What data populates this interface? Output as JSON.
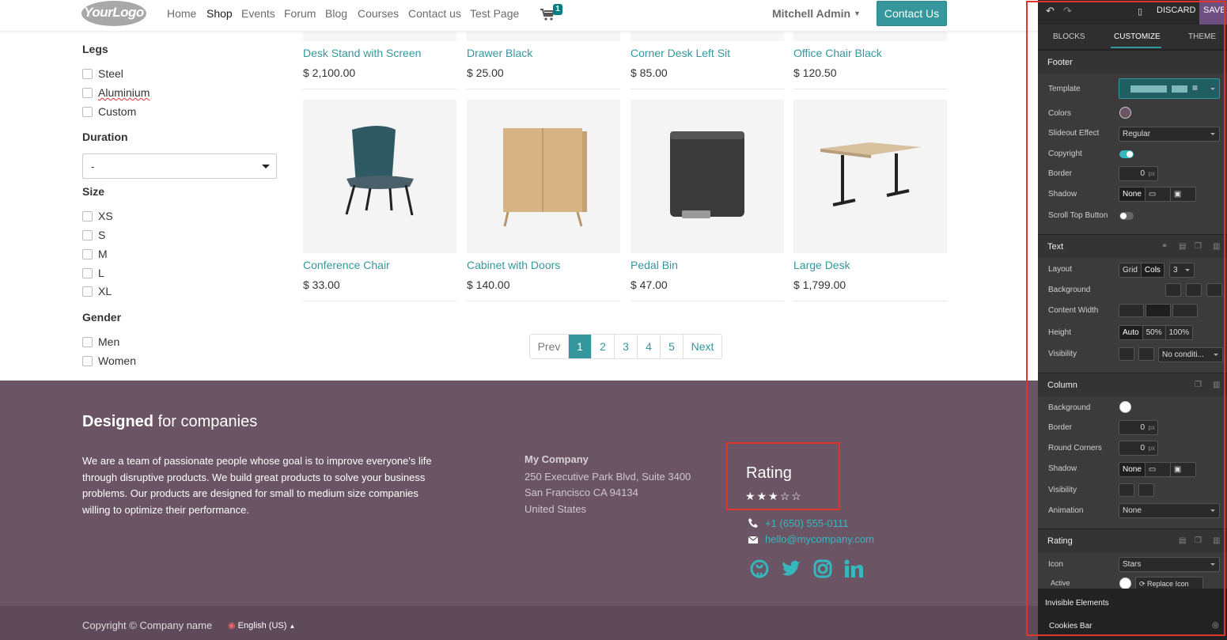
{
  "nav": {
    "logo": "YourLogo",
    "menu": [
      "Home",
      "Shop",
      "Events",
      "Forum",
      "Blog",
      "Courses",
      "Contact us",
      "Test Page"
    ],
    "active_menu": "Shop",
    "cart_count": "1",
    "user": "Mitchell Admin",
    "contact_button": "Contact Us"
  },
  "filters": {
    "legs": {
      "title": "Legs",
      "options": [
        "Steel",
        "Aluminium",
        "Custom"
      ]
    },
    "duration": {
      "title": "Duration",
      "value": "-"
    },
    "size": {
      "title": "Size",
      "options": [
        "XS",
        "S",
        "M",
        "L",
        "XL"
      ]
    },
    "gender": {
      "title": "Gender",
      "options": [
        "Men",
        "Women"
      ]
    }
  },
  "products_top": [
    {
      "name": "Desk Stand with Screen",
      "price": "$ 2,100.00"
    },
    {
      "name": "Drawer Black",
      "price": "$ 25.00"
    },
    {
      "name": "Corner Desk Left Sit",
      "price": "$ 85.00"
    },
    {
      "name": "Office Chair Black",
      "price": "$ 120.50"
    }
  ],
  "products": [
    {
      "name": "Conference Chair",
      "price": "$ 33.00",
      "image": "chair-image"
    },
    {
      "name": "Cabinet with Doors",
      "price": "$ 140.00",
      "image": "cabinet-image"
    },
    {
      "name": "Pedal Bin",
      "price": "$ 47.00",
      "image": "pedal-bin-image"
    },
    {
      "name": "Large Desk",
      "price": "$ 1,799.00",
      "image": "desk-image"
    }
  ],
  "pager": {
    "prev": "Prev",
    "pages": [
      "1",
      "2",
      "3",
      "4",
      "5"
    ],
    "active": "1",
    "next": "Next"
  },
  "footer": {
    "title_bold": "Designed",
    "title_rest": " for companies",
    "body": "We are a team of passionate people whose goal is to improve everyone's life through disruptive products. We build great products to solve your business problems. Our products are designed for small to medium size companies willing to optimize their performance.",
    "company": "My Company",
    "address": [
      "250 Executive Park Blvd, Suite 3400",
      "San Francisco CA 94134",
      "United States"
    ],
    "rating_title": "Rating",
    "rating": {
      "value": 3,
      "max": 5
    },
    "phone": "+1 (650) 555-0111",
    "email": "hello@mycompany.com",
    "social": [
      "github-icon",
      "twitter-icon",
      "instagram-icon",
      "linkedin-icon"
    ],
    "copyright": "Copyright © Company name",
    "language": "English (US)"
  },
  "panel": {
    "discard": "DISCARD",
    "save": "SAVE",
    "tabs": [
      "BLOCKS",
      "CUSTOMIZE",
      "THEME"
    ],
    "active_tab": "CUSTOMIZE",
    "footer_section": {
      "title": "Footer",
      "template": "Template",
      "colors": "Colors",
      "slideout_effect": "Slideout Effect",
      "slideout_value": "Regular",
      "copyright": "Copyright",
      "border": "Border",
      "border_value": "0",
      "unit": "px",
      "shadow": "Shadow",
      "shadow_value": "None",
      "scroll_top": "Scroll Top Button"
    },
    "text_section": {
      "title": "Text",
      "layout": "Layout",
      "layout_grid": "Grid",
      "layout_cols": "Cols",
      "layout_num": "3",
      "background": "Background",
      "content_width": "Content Width",
      "height": "Height",
      "height_auto": "Auto",
      "height_50": "50%",
      "height_100": "100%",
      "visibility": "Visibility",
      "visibility_value": "No conditi..."
    },
    "column_section": {
      "title": "Column",
      "background": "Background",
      "border": "Border",
      "border_value": "0",
      "round_corners": "Round Corners",
      "round_value": "0",
      "shadow": "Shadow",
      "shadow_value": "None",
      "visibility": "Visibility",
      "animation": "Animation",
      "animation_value": "None"
    },
    "rating_section": {
      "title": "Rating",
      "icon": "Icon",
      "icon_value": "Stars",
      "active": "Active",
      "replace_icon": "Replace Icon"
    },
    "invisible_title": "Invisible Elements",
    "cookies_bar": "Cookies Bar"
  },
  "colors": {
    "accent": "#35979c",
    "footer_bg": "#6b5565",
    "highlight": "#e0352b",
    "panel_bg": "#3b3b3b"
  }
}
